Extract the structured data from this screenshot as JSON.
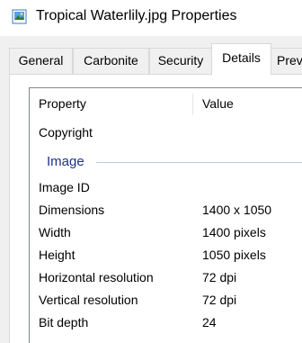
{
  "window": {
    "title": "Tropical Waterlily.jpg Properties",
    "icon": "image-file-icon"
  },
  "tabs": [
    {
      "label": "General",
      "active": false
    },
    {
      "label": "Carbonite",
      "active": false
    },
    {
      "label": "Security",
      "active": false
    },
    {
      "label": "Details",
      "active": true
    },
    {
      "label": "Prev",
      "active": false
    }
  ],
  "details": {
    "columns": {
      "property": "Property",
      "value": "Value"
    },
    "rows_top": [
      {
        "property": "Copyright",
        "value": ""
      }
    ],
    "group": {
      "label": "Image"
    },
    "rows": [
      {
        "property": "Image ID",
        "value": ""
      },
      {
        "property": "Dimensions",
        "value": "1400 x 1050"
      },
      {
        "property": "Width",
        "value": "1400 pixels"
      },
      {
        "property": "Height",
        "value": "1050 pixels"
      },
      {
        "property": "Horizontal resolution",
        "value": "72 dpi"
      },
      {
        "property": "Vertical resolution",
        "value": "72 dpi"
      },
      {
        "property": "Bit depth",
        "value": "24"
      }
    ]
  }
}
